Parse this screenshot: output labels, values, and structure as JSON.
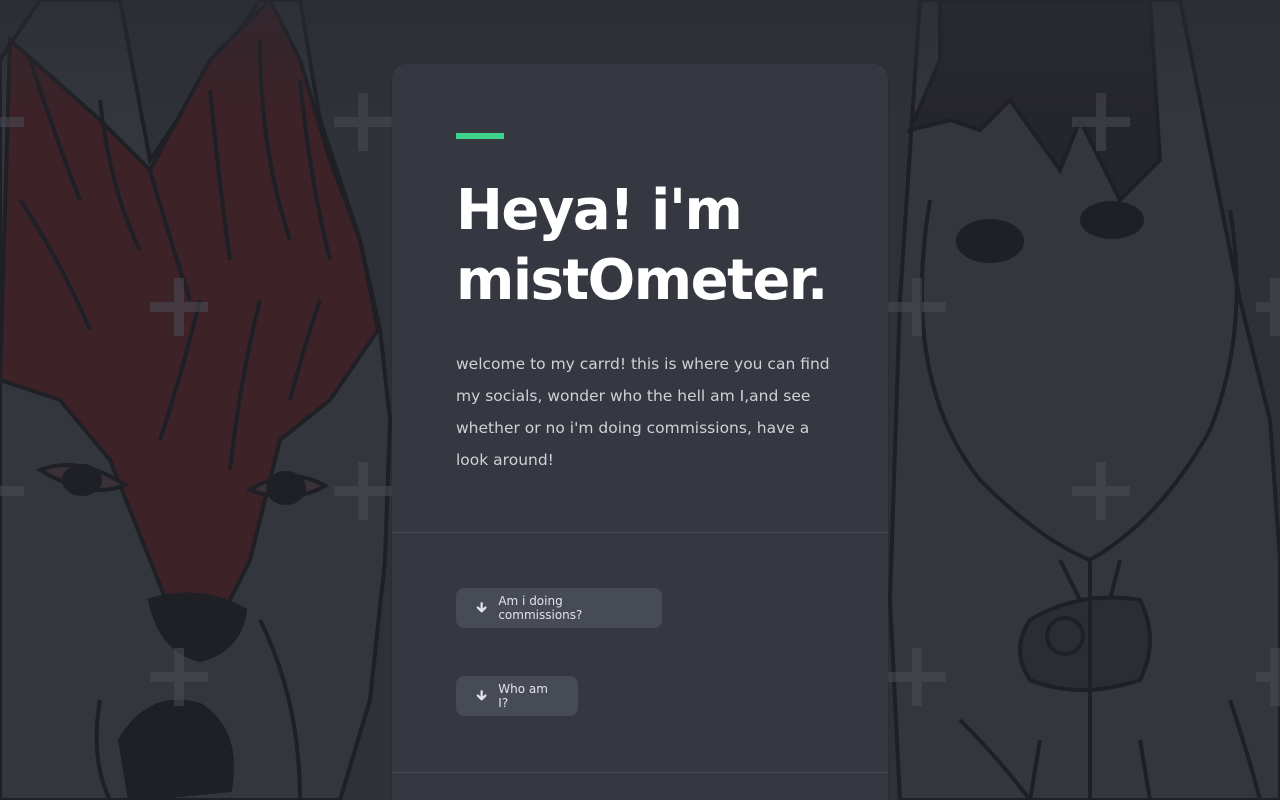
{
  "theme": {
    "page_background": "#2f3138",
    "card_background": "#353841",
    "accent": "#3fd48b",
    "button_background": "#474b55",
    "heading_color": "#ffffff",
    "body_text_color": "#cfd1d6"
  },
  "background": {
    "icon": "plus-pattern-icon"
  },
  "card": {
    "headline_line1": "Heya! i'm",
    "headline_line2": "mistOmeter.",
    "intro": "welcome to my carrd! this is where you can find my socials, wonder who the hell am I,and see whether or no i'm doing commissions, have a look around!"
  },
  "buttons": [
    {
      "label": "Am i doing commissions?",
      "icon": "arrow-down-icon"
    },
    {
      "label": "Who am I?",
      "icon": "arrow-down-icon"
    }
  ]
}
